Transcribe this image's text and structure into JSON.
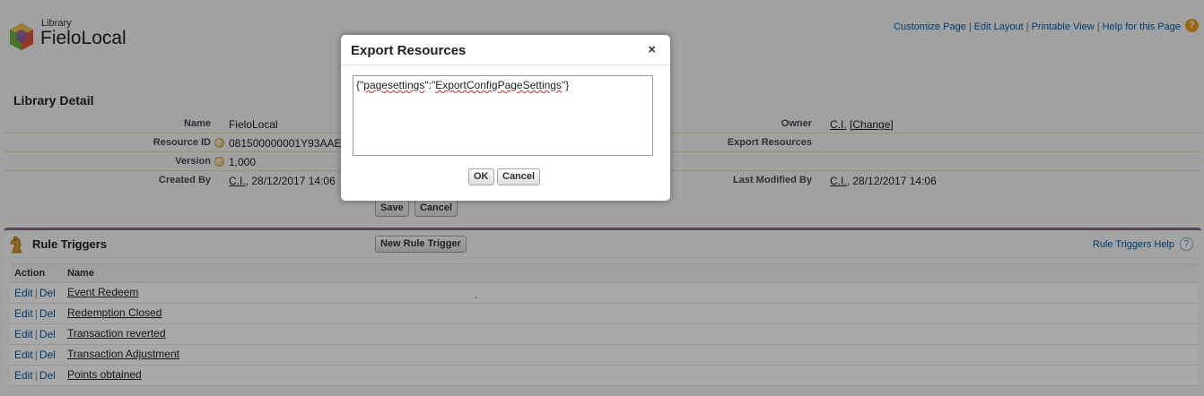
{
  "header": {
    "object_type": "Library",
    "record_name": "FieloLocal",
    "links": [
      "Customize Page",
      "Edit Layout",
      "Printable View",
      "Help for this Page"
    ],
    "help_glyph": "?"
  },
  "detail": {
    "section_title": "Library Detail",
    "left_fields": [
      {
        "label": "Name",
        "value": "FieloLocal"
      },
      {
        "label": "Resource ID",
        "value": "081500000001Y93AAE"
      },
      {
        "label": "Version",
        "value": "1,000"
      },
      {
        "label": "Created By",
        "user": "C.I.",
        "date": ", 28/12/2017 14:06"
      }
    ],
    "right_fields": [
      {
        "label": "Owner",
        "user": "C.I.",
        "change": "[Change]"
      },
      {
        "label": "Export Resources",
        "value": ""
      },
      {
        "label": "Last Modified By",
        "user": "C.I.",
        "date": ", 28/12/2017 14:06"
      }
    ],
    "buttons": {
      "save": "Save",
      "cancel": "Cancel"
    }
  },
  "related_list": {
    "title": "Rule Triggers",
    "new_button": "New Rule Trigger",
    "help_link": "Rule Triggers Help",
    "help_glyph": "?",
    "columns": [
      "Action",
      "Name"
    ],
    "action_edit": "Edit",
    "action_del": "Del",
    "rows": [
      "Event Redeem",
      "Redemption Closed",
      "Transaction reverted",
      "Transaction Adjustment",
      "Points obtained"
    ],
    "stray_mark": "."
  },
  "modal": {
    "title": "Export Resources",
    "close_glyph": "×",
    "text_value": "{\"pagesettings\":\"ExportConfigPageSettings\"}",
    "text_parts": [
      "{\"",
      "pagesettings",
      "\":\"",
      "ExportConfigPageSettings",
      "\"}"
    ],
    "ok_label": "OK",
    "cancel_label": "Cancel"
  },
  "colors": {
    "link": "#015ba7",
    "related_list_accent": "#8a6a8c",
    "help_icon": "#e59f1c"
  },
  "icons": {
    "logo": "library-cube-icon",
    "related_list": "trophy-horse-icon"
  }
}
